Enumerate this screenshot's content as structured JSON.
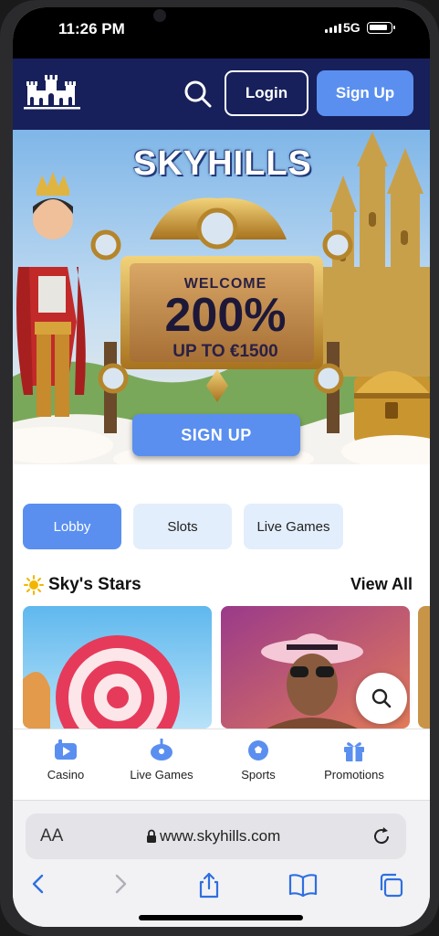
{
  "status_bar": {
    "time": "11:26 PM",
    "network": "5G"
  },
  "header": {
    "login_label": "Login",
    "signup_label": "Sign Up",
    "search_icon": "search-icon",
    "brand_color": "#17205a",
    "accent": "#5a8ff0"
  },
  "banner": {
    "brand": "SKYHILLS",
    "welcome": "WELCOME",
    "bonus_percent": "200%",
    "bonus_upto": "UP TO €1500",
    "cta": "SIGN UP"
  },
  "tabs": [
    {
      "label": "Lobby",
      "active": true
    },
    {
      "label": "Slots",
      "active": false
    },
    {
      "label": "Live Games",
      "active": false
    }
  ],
  "section": {
    "title": "Sky's Stars",
    "view_all": "View All",
    "icon": "sun-icon"
  },
  "bottom_nav": [
    {
      "label": "Casino",
      "icon": "casino-icon"
    },
    {
      "label": "Live Games",
      "icon": "live-games-icon"
    },
    {
      "label": "Sports",
      "icon": "sports-icon"
    },
    {
      "label": "Promotions",
      "icon": "promotions-icon"
    }
  ],
  "browser": {
    "text_size_label": "AA",
    "url": "www.skyhills.com"
  }
}
